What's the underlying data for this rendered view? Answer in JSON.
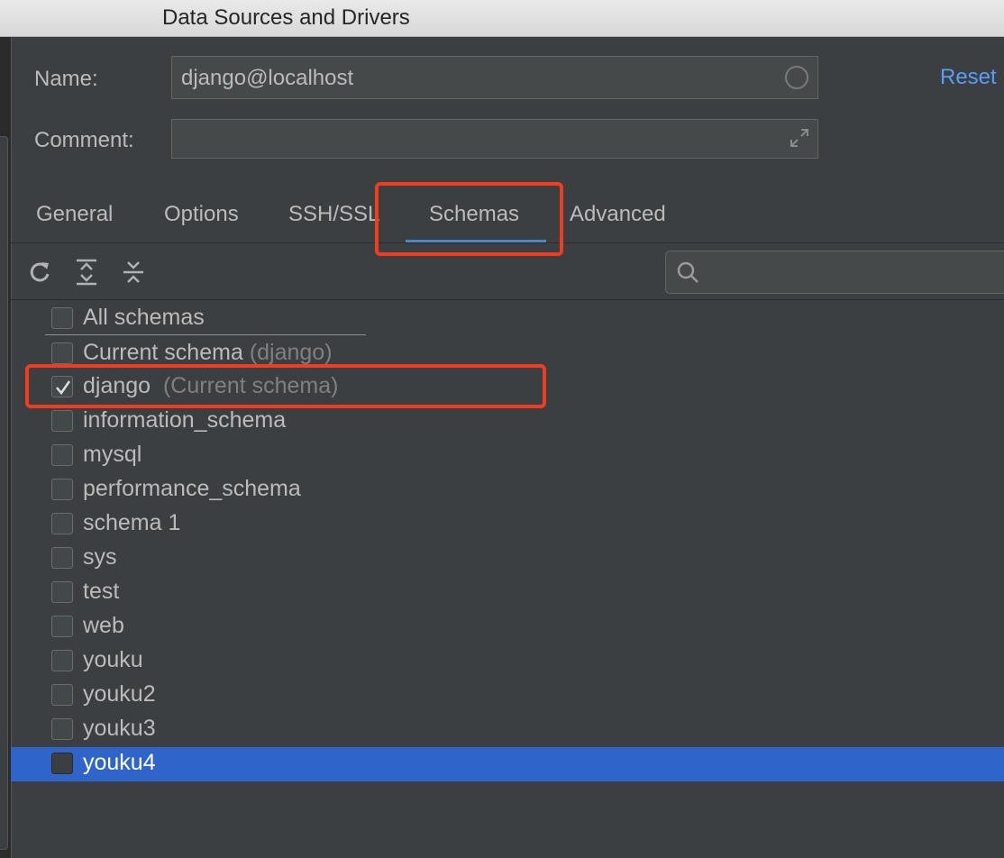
{
  "window": {
    "title": "Data Sources and Drivers"
  },
  "form": {
    "name_label": "Name:",
    "name_value": "django@localhost",
    "comment_label": "Comment:",
    "comment_value": "",
    "reset_label": "Reset"
  },
  "tabs": [
    {
      "label": "General",
      "active": false
    },
    {
      "label": "Options",
      "active": false
    },
    {
      "label": "SSH/SSL",
      "active": false
    },
    {
      "label": "Schemas",
      "active": true
    },
    {
      "label": "Advanced",
      "active": false
    }
  ],
  "toolbar": {
    "icons": [
      "refresh-icon",
      "expand-all-icon",
      "collapse-all-icon",
      "search-icon"
    ],
    "search_placeholder": ""
  },
  "schemas": {
    "all": {
      "label": "All schemas",
      "checked": false
    },
    "current": {
      "label": "Current schema",
      "note": "(django)",
      "checked": false
    },
    "items": [
      {
        "label": "django",
        "note": "(Current schema)",
        "checked": true,
        "selected": false
      },
      {
        "label": "information_schema",
        "checked": false,
        "selected": false
      },
      {
        "label": "mysql",
        "checked": false,
        "selected": false
      },
      {
        "label": "performance_schema",
        "checked": false,
        "selected": false
      },
      {
        "label": "schema 1",
        "checked": false,
        "selected": false
      },
      {
        "label": "sys",
        "checked": false,
        "selected": false
      },
      {
        "label": "test",
        "checked": false,
        "selected": false
      },
      {
        "label": "web",
        "checked": false,
        "selected": false
      },
      {
        "label": "youku",
        "checked": false,
        "selected": false
      },
      {
        "label": "youku2",
        "checked": false,
        "selected": false
      },
      {
        "label": "youku3",
        "checked": false,
        "selected": false
      },
      {
        "label": "youku4",
        "checked": false,
        "selected": true
      }
    ]
  },
  "colors": {
    "background": "#3c3f41",
    "selection": "#2f65ca",
    "link": "#589df6",
    "tab_underline": "#4a88c7",
    "highlight_annotation": "#f23c1f"
  }
}
